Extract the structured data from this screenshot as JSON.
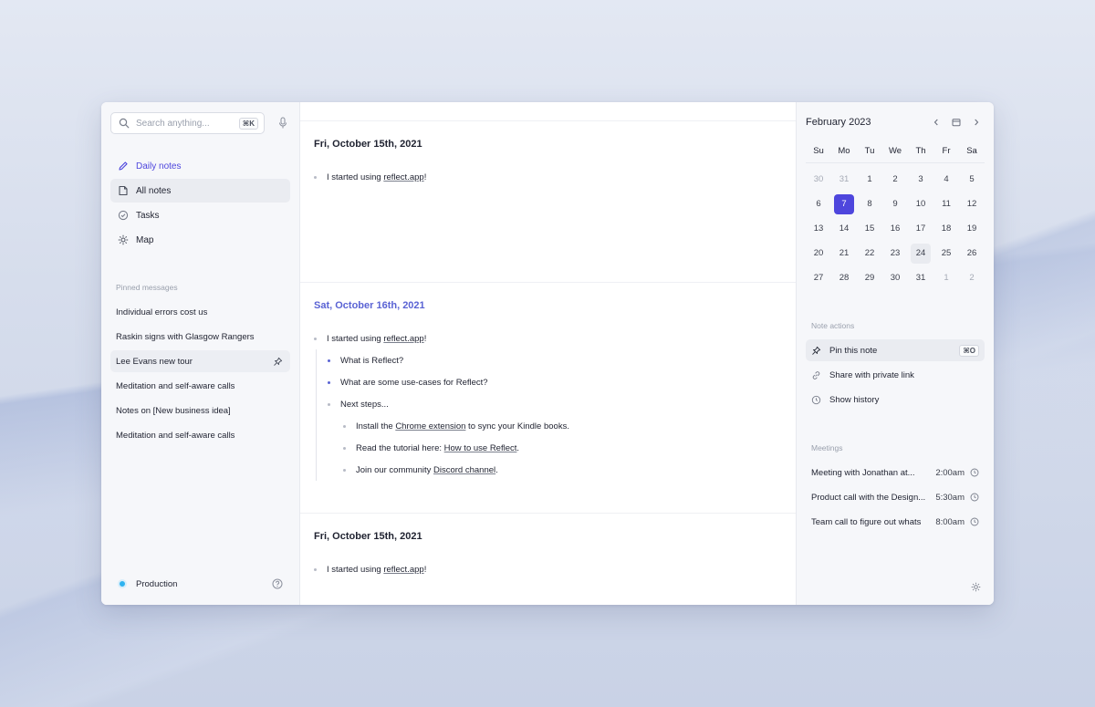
{
  "search": {
    "placeholder": "Search anything...",
    "shortcut": "⌘K"
  },
  "nav": [
    {
      "label": "Daily notes",
      "icon": "pencil-icon"
    },
    {
      "label": "All notes",
      "icon": "note-icon"
    },
    {
      "label": "Tasks",
      "icon": "check-circle-icon"
    },
    {
      "label": "Map",
      "icon": "sun-graph-icon"
    }
  ],
  "pinned": {
    "label": "Pinned messages",
    "items": [
      "Individual errors cost us",
      "Raskin signs with Glasgow Rangers",
      "Lee Evans new tour",
      "Meditation and self-aware calls",
      "Notes on [New business idea]",
      "Meditation and self-aware calls"
    ]
  },
  "footer": {
    "label": "Production",
    "status_color": "#2fb3f0"
  },
  "notes": {
    "day1": {
      "title": "Fri, October 15th, 2021",
      "prefix": "I started using",
      "link": "reflect.app",
      "suffix": " !"
    },
    "day2": {
      "title": "Sat, October 16th, 2021",
      "prefix": "I started using",
      "link": "reflect.app",
      "suffix": " !",
      "q1": "What is Reflect?",
      "q2": "What are some use-cases for Reflect?",
      "next": "Next steps...",
      "s1_pre": "Install the ",
      "s1_link": "Chrome extension",
      "s1_post": " to sync your Kindle books.",
      "s2_pre": "Read the tutorial here: ",
      "s2_link": "How to use Reflect",
      "s2_post": ".",
      "s3_pre": "Join our community ",
      "s3_link": "Discord channel",
      "s3_post": "."
    },
    "day3": {
      "title": "Fri, October 15th, 2021",
      "prefix": "I started using",
      "link": "reflect.app",
      "suffix": " !"
    }
  },
  "calendar": {
    "title": "February 2023",
    "dow": [
      "Su",
      "Mo",
      "Tu",
      "We",
      "Th",
      "Fr",
      "Sa"
    ],
    "weeks": [
      [
        "30",
        "31",
        "1",
        "2",
        "3",
        "4",
        "5"
      ],
      [
        "6",
        "7",
        "8",
        "9",
        "10",
        "11",
        "12"
      ],
      [
        "13",
        "14",
        "15",
        "16",
        "17",
        "18",
        "19"
      ],
      [
        "20",
        "21",
        "22",
        "23",
        "24",
        "25",
        "26"
      ],
      [
        "27",
        "28",
        "29",
        "30",
        "31",
        "1",
        "2"
      ]
    ],
    "selected": "7",
    "accent": "#4e46dd"
  },
  "actions": {
    "label": "Note actions",
    "pin": {
      "label": "Pin this note",
      "shortcut": "⌘O"
    },
    "share": {
      "label": "Share with private link"
    },
    "history": {
      "label": "Show history"
    }
  },
  "meetings": {
    "label": "Meetings",
    "items": [
      {
        "title": "Meeting with Jonathan at...",
        "time": "2:00am"
      },
      {
        "title": "Product call with the Design...",
        "time": "5:30am"
      },
      {
        "title": "Team call to figure out whats",
        "time": "8:00am"
      }
    ]
  }
}
